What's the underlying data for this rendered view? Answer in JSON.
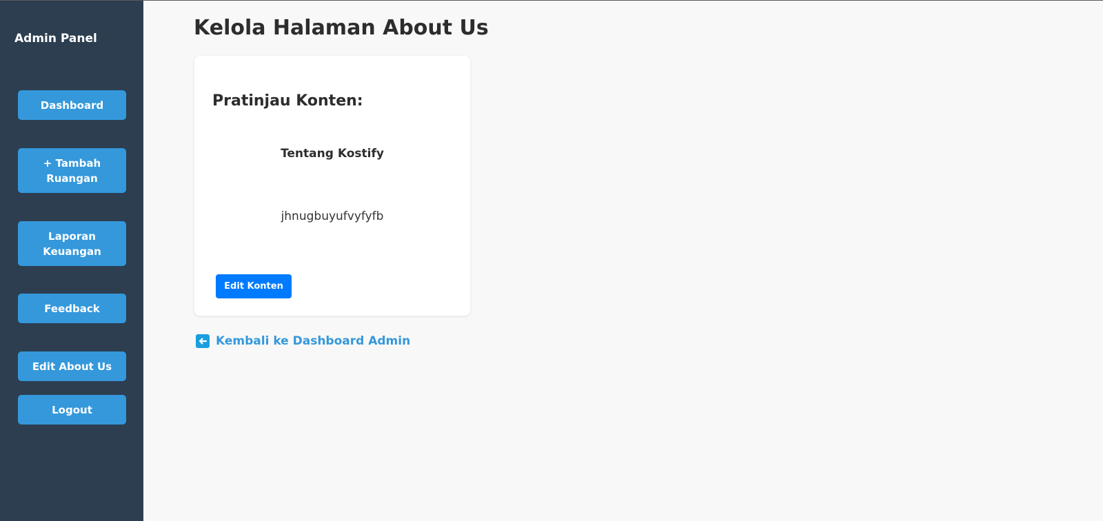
{
  "sidebar": {
    "title": "Admin Panel",
    "items": [
      {
        "label": "Dashboard"
      },
      {
        "label": "+ Tambah Ruangan"
      },
      {
        "label": "Laporan Keuangan"
      },
      {
        "label": "Feedback"
      },
      {
        "label": "Edit About Us"
      },
      {
        "label": "Logout"
      }
    ]
  },
  "main": {
    "title": "Kelola Halaman About Us",
    "card": {
      "heading": "Pratinjau Konten:",
      "preview_title": "Tentang Kostify",
      "preview_body": "jhnugbuyufvyfyfb",
      "edit_button": "Edit Konten"
    },
    "back_link": {
      "label": "Kembali ke Dashboard Admin",
      "icon": "arrow-left-icon"
    }
  },
  "colors": {
    "sidebar_bg": "#2c3e50",
    "nav_button": "#3498db",
    "primary_button": "#007bff",
    "link": "#3498db",
    "page_bg": "#f8f8f8"
  }
}
